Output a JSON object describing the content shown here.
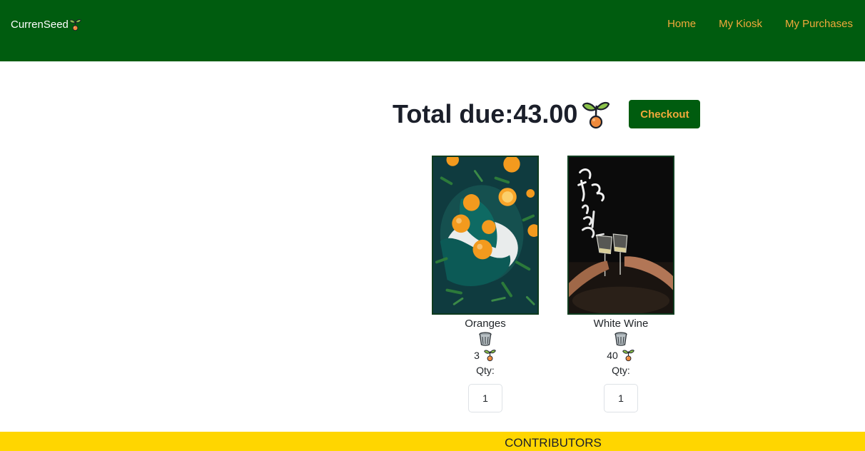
{
  "brand": {
    "name": "CurrenSeed",
    "icon": "sprout-icon"
  },
  "nav": {
    "links": [
      "Home",
      "My Kiosk",
      "My Purchases"
    ]
  },
  "cart": {
    "total_label": "Total due:",
    "total_value": "43.00",
    "checkout_label": "Checkout",
    "items": [
      {
        "name": "Oranges",
        "price": "3",
        "qty_label": "Qty:",
        "qty": "1"
      },
      {
        "name": "White Wine",
        "price": "40",
        "qty_label": "Qty:",
        "qty": "1"
      }
    ]
  },
  "footer": {
    "label": "CONTRIBUTORS"
  },
  "colors": {
    "navbar": "#005c0f",
    "nav_link": "#f2a93b",
    "footer": "#ffd600",
    "card_border": "#0e3b1e"
  }
}
